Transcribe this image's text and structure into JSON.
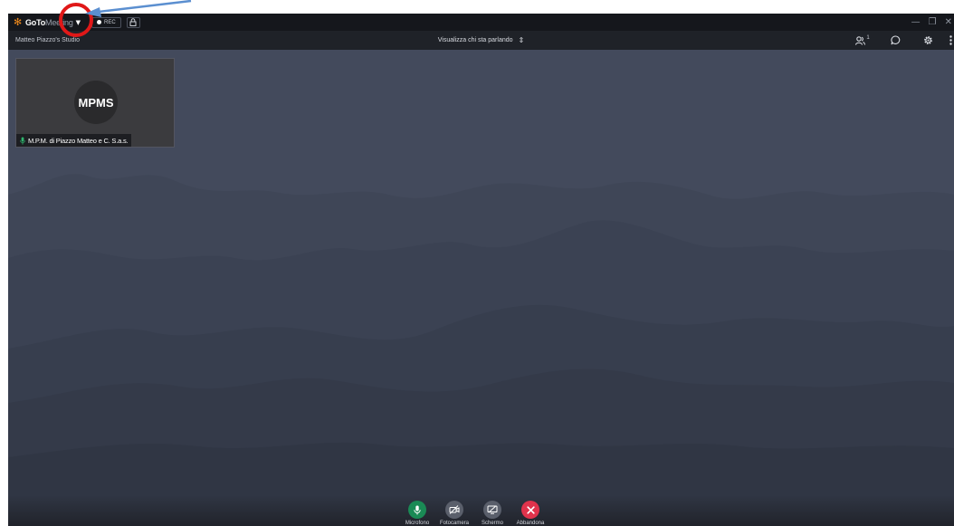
{
  "app": {
    "brand_primary": "GoTo",
    "brand_secondary": "Meeting",
    "rec_label": "REC",
    "meeting_name": "Matteo Piazzo's Studio",
    "view_mode": "Visualizza chi sta parlando",
    "participant_count": "1",
    "accent_color": "#f08a1c"
  },
  "participants": [
    {
      "initials": "MPMS",
      "name": "M.P.M. di Piazzo Matteo e C. S.a.s.",
      "mic_color": "#2fb36c"
    }
  ],
  "controls": [
    {
      "label": "Microfono",
      "icon": "microphone-icon",
      "color": "#1a8a55"
    },
    {
      "label": "Fotocamera",
      "icon": "camera-off-icon",
      "color": "#5a5f6b"
    },
    {
      "label": "Schermo",
      "icon": "screen-share-icon",
      "color": "#5a5f6b"
    },
    {
      "label": "Abbandona",
      "icon": "close-icon",
      "color": "#e0334c"
    }
  ],
  "annotation": {
    "highlight_color": "#e01818",
    "arrow_color": "#5b8fd0"
  }
}
